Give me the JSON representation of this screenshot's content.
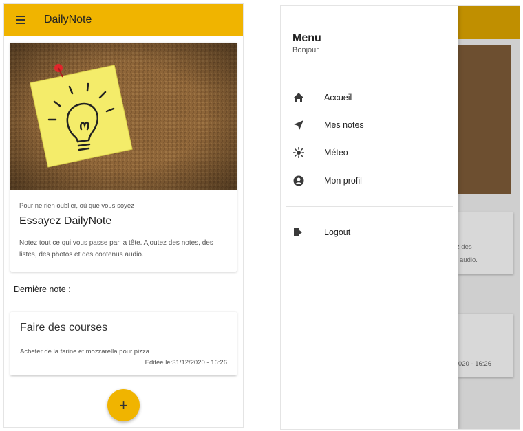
{
  "left_screen": {
    "appbar": {
      "title": "DailyNote",
      "color": "#f0b400"
    },
    "promo": {
      "caption": "Pour ne rien oublier, où que vous soyez",
      "title": "Essayez DailyNote",
      "text": "Notez tout ce qui vous passe par la tête. Ajoutez des notes, des listes, des photos et des contenus audio."
    },
    "last_note_label": "Dernière note :",
    "note": {
      "title": "Faire des courses",
      "body": "Acheter de la farine et mozzarella pour pizza",
      "edited": "Editée le:31/12/2020 - 16:26"
    },
    "fab_label": "+"
  },
  "right_screen": {
    "drawer": {
      "title": "Menu",
      "subtitle": "Bonjour",
      "items": [
        {
          "label": "Accueil",
          "icon": "home-icon"
        },
        {
          "label": "Mes notes",
          "icon": "send-icon"
        },
        {
          "label": "Méteo",
          "icon": "sun-icon"
        },
        {
          "label": "Mon profil",
          "icon": "account-icon"
        }
      ],
      "logout": {
        "label": "Logout",
        "icon": "logout-icon"
      }
    },
    "background": {
      "text_line1": "tez des",
      "text_line2": "audio.",
      "date": "/2020 - 16:26"
    }
  }
}
